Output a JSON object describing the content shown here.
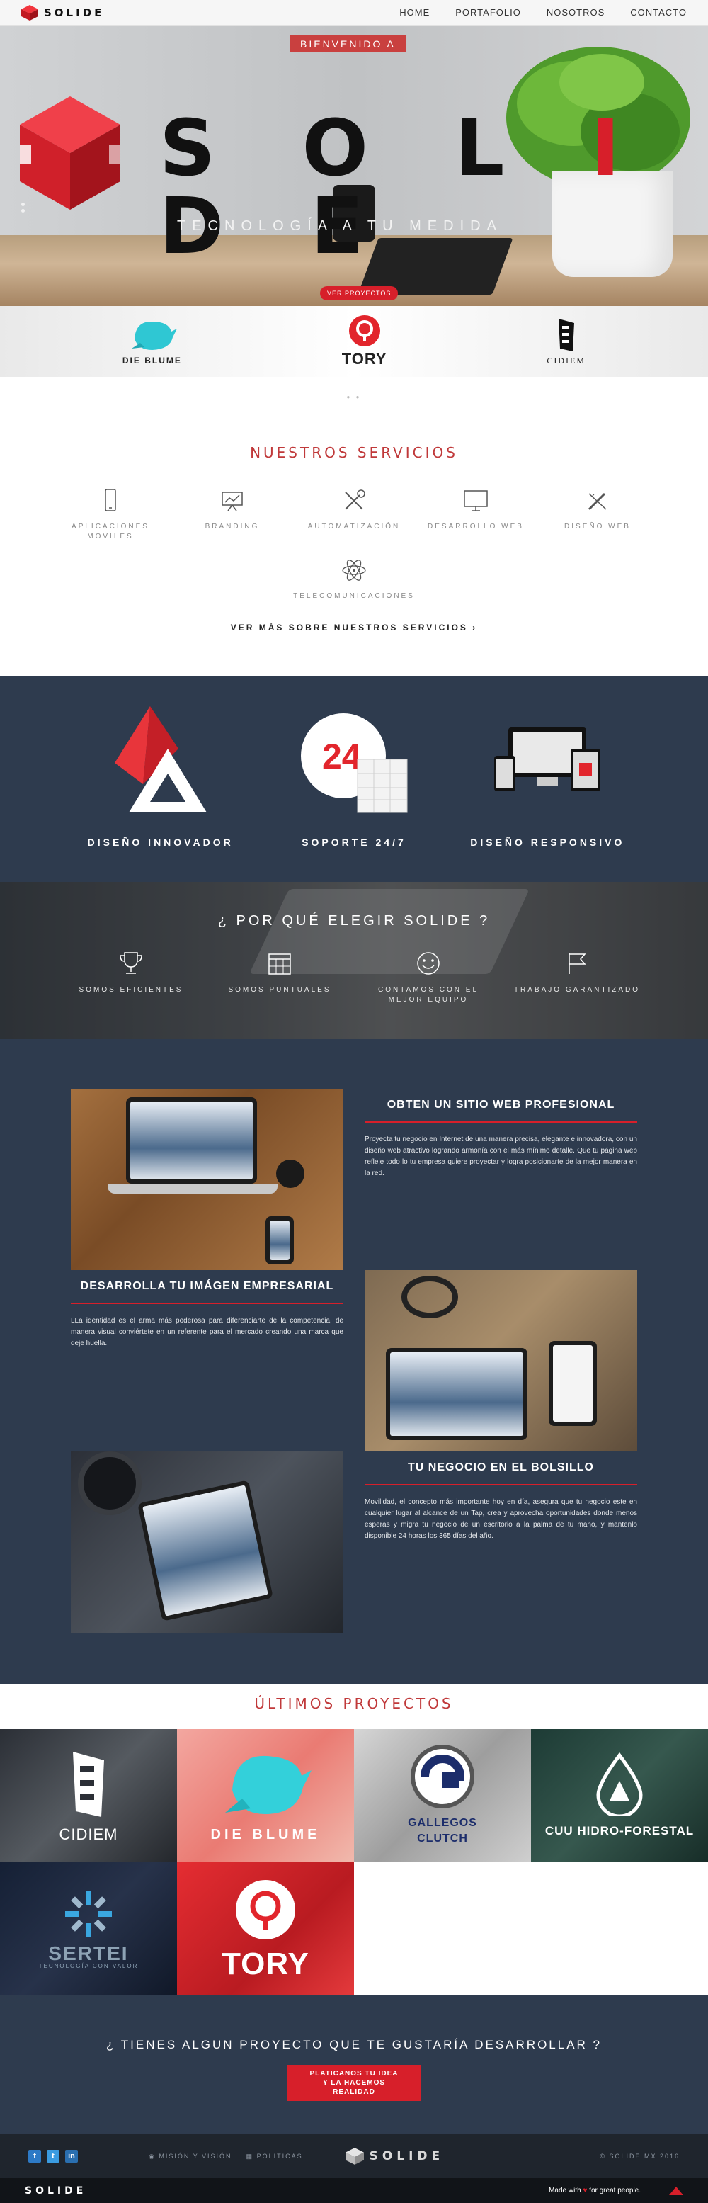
{
  "nav": {
    "brand": "SOLIDE",
    "items": [
      "HOME",
      "PORTAFOLIO",
      "NOSOTROS",
      "CONTACTO"
    ]
  },
  "hero": {
    "welcome": "BIENVENIDO A",
    "logo_parts": [
      "S O L ",
      "I",
      " D E"
    ],
    "tagline": "TECNOLOGÍA A TU MEDIDA",
    "cta": "VER PROYECTOS"
  },
  "clients": [
    {
      "name": "DIE BLUME",
      "icon": "bird-icon"
    },
    {
      "name": "TORY",
      "icon": "location-pin-icon"
    },
    {
      "name": "CIDIEM",
      "icon": "tower-icon"
    }
  ],
  "services": {
    "title": "NUESTROS SERVICIOS",
    "items": [
      {
        "label": "APLICACIONES MOVILES",
        "icon": "smartphone-icon"
      },
      {
        "label": "BRANDING",
        "icon": "presentation-icon"
      },
      {
        "label": "AUTOMATIZACIÓN",
        "icon": "tools-icon"
      },
      {
        "label": "DESARROLLO WEB",
        "icon": "monitor-icon"
      },
      {
        "label": "DISEÑO WEB",
        "icon": "pencil-ruler-icon"
      },
      {
        "label": "TELECOMUNICACIONES",
        "icon": "atom-icon"
      }
    ],
    "more": "VER MÁS SOBRE NUESTROS SERVICIOS ›"
  },
  "features": [
    {
      "label": "DISEÑO INNOVADOR",
      "art": "triangle-logo"
    },
    {
      "label": "SOPORTE 24/7",
      "art": "clock-24"
    },
    {
      "label": "DISEÑO RESPONSIVO",
      "art": "devices"
    }
  ],
  "why": {
    "title": "¿ POR QUÉ ELEGIR SOLIDE ?",
    "items": [
      {
        "label": "SOMOS EFICIENTES",
        "icon": "trophy-icon"
      },
      {
        "label": "SOMOS PUNTUALES",
        "icon": "calendar-icon"
      },
      {
        "label": "CONTAMOS CON EL MEJOR EQUIPO",
        "icon": "smiley-icon"
      },
      {
        "label": "TRABAJO GARANTIZADO",
        "icon": "flag-icon"
      }
    ]
  },
  "benefits": [
    {
      "title": "OBTEN UN SITIO WEB PROFESIONAL",
      "body": "Proyecta tu negocio en Internet de una manera precisa, elegante e innovadora, con un diseño web atractivo logrando armonía con el más mínimo detalle. Que tu página web refleje todo lo tu empresa quiere proyectar y logra posicionarte de la mejor manera en la red."
    },
    {
      "title": "DESARROLLA TU IMÁGEN EMPRESARIAL",
      "body": "LLa identidad es el arma más poderosa para diferenciarte de la competencia, de manera visual conviértete en un referente para el mercado creando una marca que deje huella."
    },
    {
      "title": "TU NEGOCIO EN EL BOLSILLO",
      "body": "Movilidad, el concepto más importante hoy en día, asegura que tu negocio este en cualquier lugar al alcance de un Tap, crea y aprovecha oportunidades donde menos esperas y migra tu negocio de un escritorio a la palma de tu mano, y mantenlo disponible 24 horas los 365 días del año."
    }
  ],
  "projects": {
    "title": "ÚLTIMOS PROYECTOS",
    "items": [
      "CIDIEM",
      "DIE BLUME",
      "GALLEGOS CLUTCH",
      "CUU HIDRO-FORESTAL",
      "SERTEI",
      "TORY"
    ],
    "sertei_sub": "TECNOLOGÍA CON VALOR"
  },
  "cta": {
    "text": "¿ TIENES ALGUN PROYECTO QUE TE GUSTARÍA DESARROLLAR ?",
    "button": "PLATICANOS TU IDEA Y LA HACEMOS REALIDAD"
  },
  "footer": {
    "links": [
      "MISIÓN Y VISIÓN",
      "POLÍTICAS"
    ],
    "brand": "SOLIDE",
    "copyright": "© SOLIDE MX 2016",
    "bottom_brand": "SOLIDE",
    "made_with_prefix": "Made with",
    "made_with_suffix": "for great people."
  },
  "colors": {
    "accent": "#d71f2a",
    "navy": "#2e3b4e",
    "footer": "#1f252d"
  }
}
